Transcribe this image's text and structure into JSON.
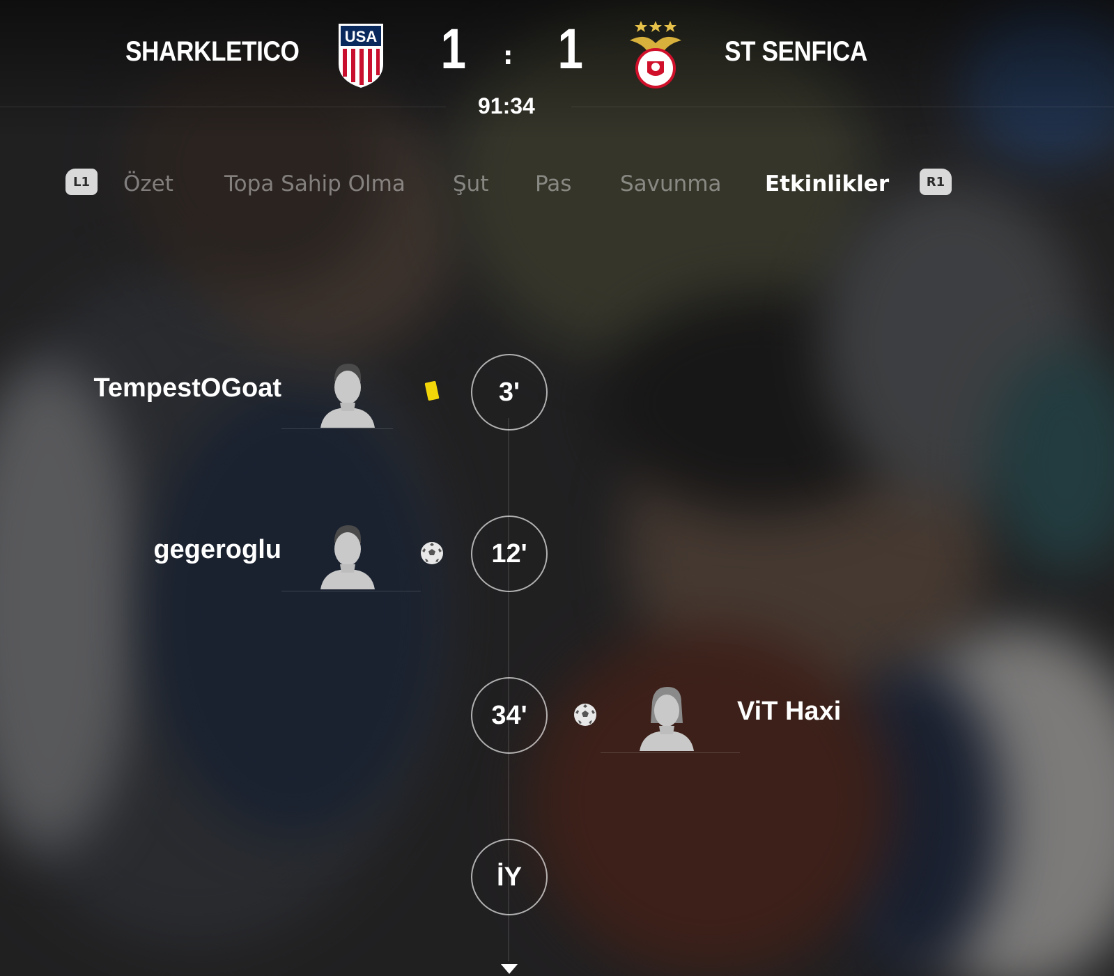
{
  "header": {
    "home_team": "SHARKLETICO",
    "away_team": "ST SENFICA",
    "home_score": "1",
    "away_score": "1",
    "separator": ":",
    "clock": "91:34",
    "home_crest_text": "USA",
    "home_crest_icon": "usa-crest-icon",
    "away_crest_icon": "eagle-crest-icon"
  },
  "tabs": {
    "left_button": "L1",
    "right_button": "R1",
    "items": [
      {
        "label": "Özet",
        "active": false
      },
      {
        "label": "Topa Sahip Olma",
        "active": false
      },
      {
        "label": "Şut",
        "active": false
      },
      {
        "label": "Pas",
        "active": false
      },
      {
        "label": "Savunma",
        "active": false
      },
      {
        "label": "Etkinlikler",
        "active": true
      }
    ]
  },
  "events": [
    {
      "minute": "3'",
      "side": "home",
      "player": "TempestOGoat",
      "type": "yellow-card"
    },
    {
      "minute": "12'",
      "side": "home",
      "player": "gegeroglu",
      "type": "goal"
    },
    {
      "minute": "34'",
      "side": "away",
      "player": "ViT Haxi",
      "type": "goal"
    },
    {
      "minute": "İY",
      "side": "none",
      "player": "",
      "type": "half-time"
    }
  ],
  "colors": {
    "yellow_card": "#f2d60a",
    "usa_red": "#c8102e",
    "usa_navy": "#0a2a5e",
    "benfica_red": "#d0102a",
    "tab_inactive": "rgba(255,255,255,0.42)"
  }
}
